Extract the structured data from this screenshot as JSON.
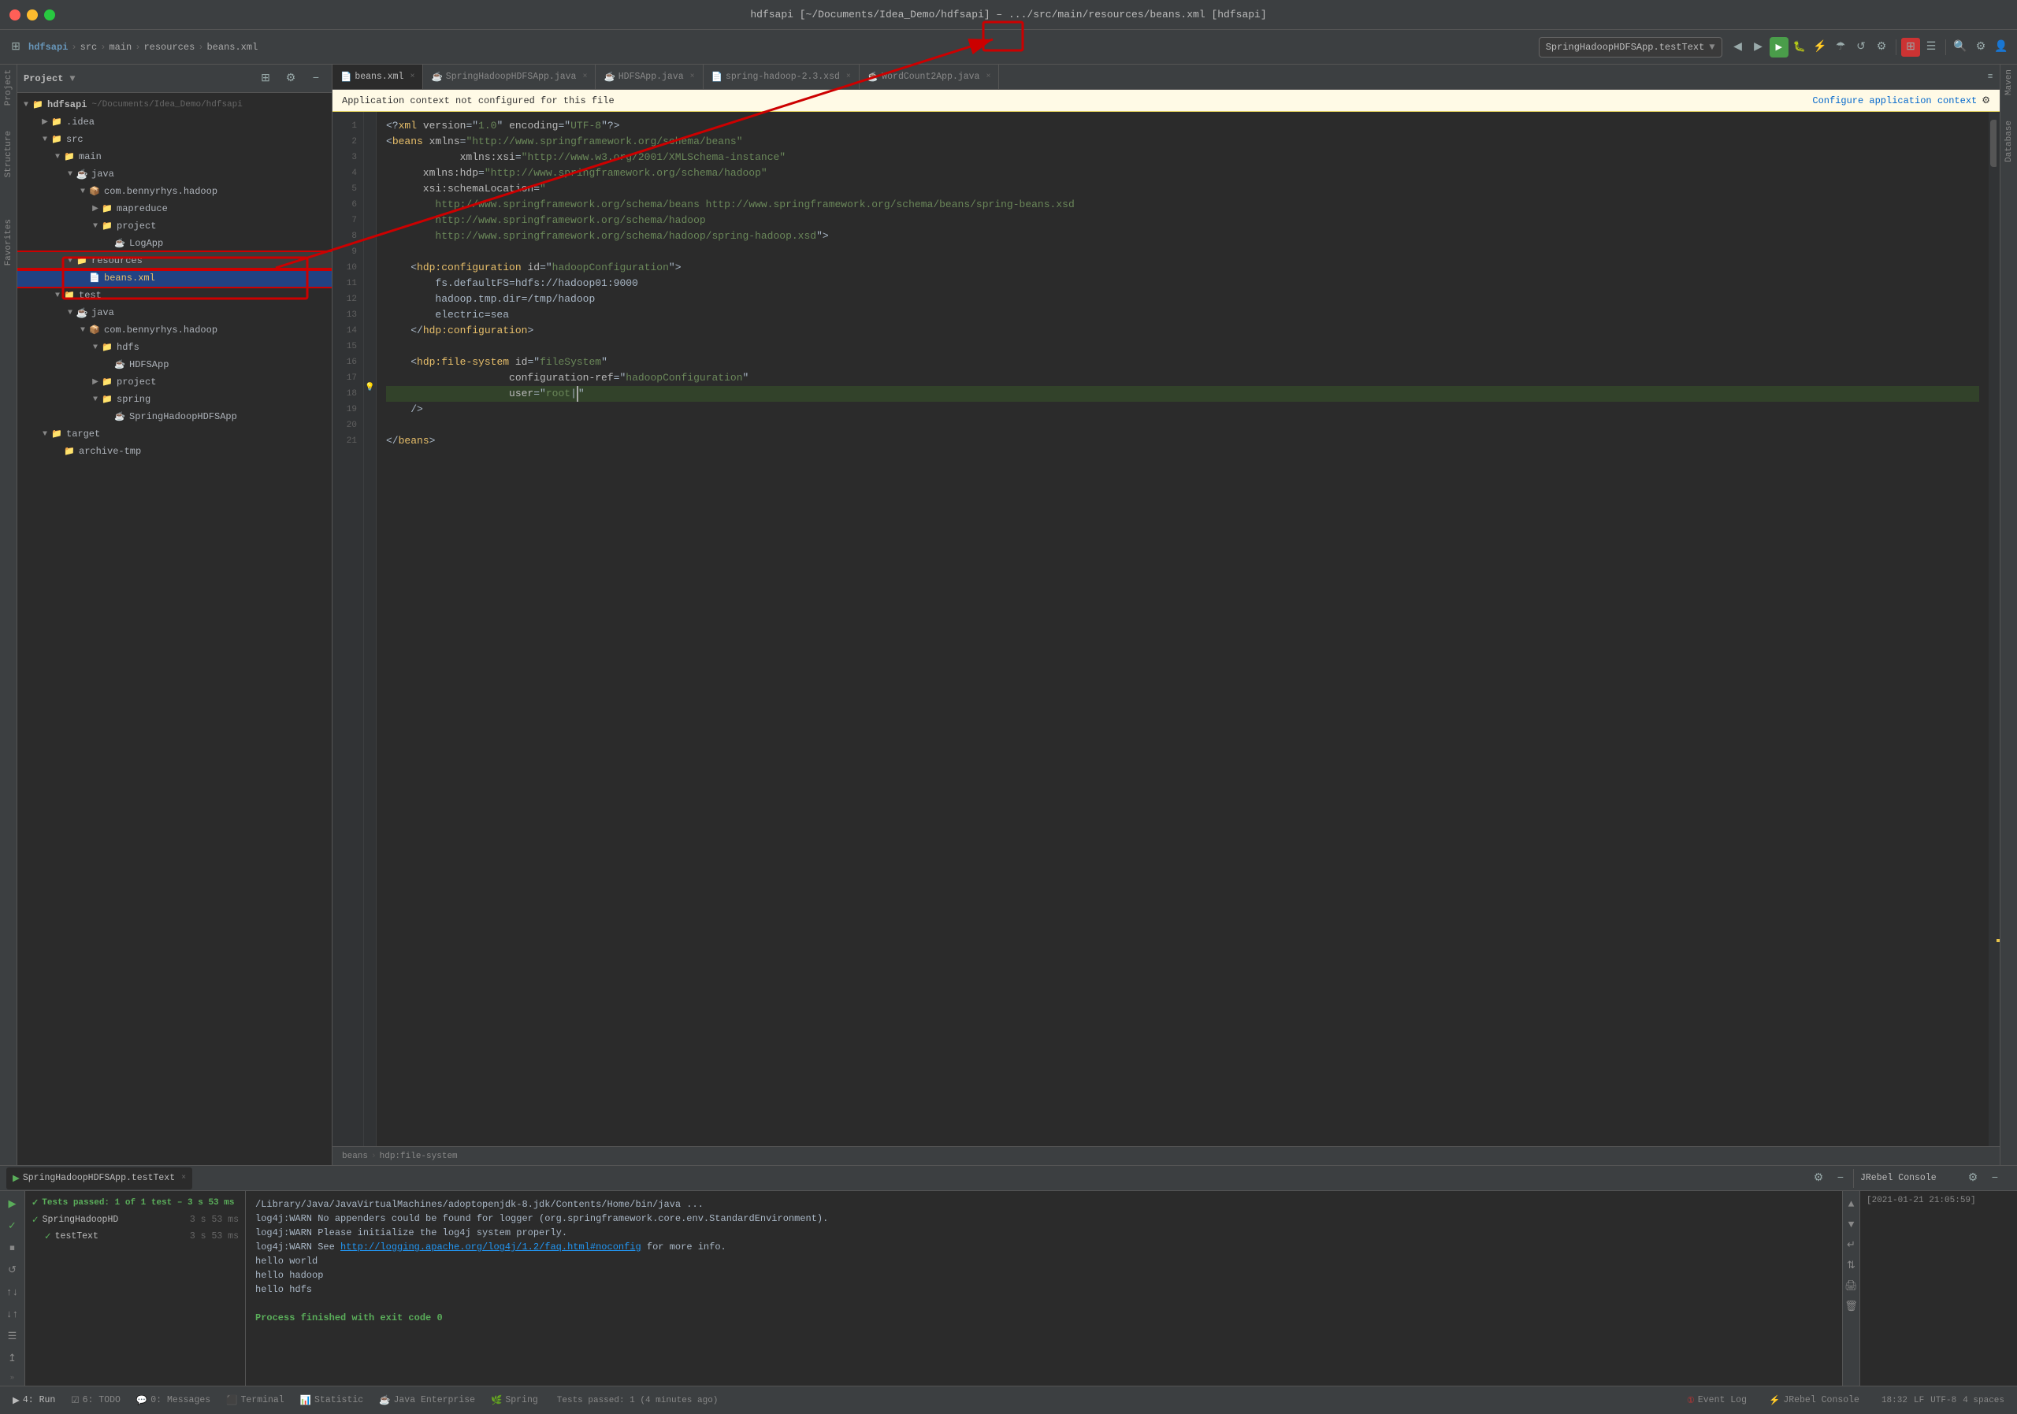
{
  "title_bar": {
    "title": "hdfsapi [~/Documents/Idea_Demo/hdfsapi] – .../src/main/resources/beans.xml [hdfsapi]"
  },
  "nav": {
    "breadcrumbs": [
      "hdfsapi",
      "src",
      "main",
      "resources",
      "beans.xml"
    ]
  },
  "editor_tabs": [
    {
      "label": "beans.xml",
      "active": true,
      "icon": "xml"
    },
    {
      "label": "SpringHadoopHDFSApp.java",
      "active": false,
      "icon": "java"
    },
    {
      "label": "HDFSApp.java",
      "active": false,
      "icon": "java"
    },
    {
      "label": "spring-hadoop-2.3.xsd",
      "active": false,
      "icon": "xsd"
    },
    {
      "label": "WordCount2App.java",
      "active": false,
      "icon": "java"
    }
  ],
  "warning": {
    "text": "Application context not configured for this file",
    "link_text": "Configure application context",
    "gear": "⚙"
  },
  "code": {
    "lines": [
      {
        "num": 1,
        "content": "<?xml version=\"1.0\" encoding=\"UTF-8\"?>"
      },
      {
        "num": 2,
        "content": "<beans xmlns=\"http://www.springframework.org/schema/beans\""
      },
      {
        "num": 3,
        "content": "      xmlns:xsi=\"http://www.w3.org/2001/XMLSchema-instance\""
      },
      {
        "num": 4,
        "content": "      xmlns:hdp=\"http://www.springframework.org/schema/hadoop\""
      },
      {
        "num": 5,
        "content": "      xsi:schemaLocation="
      },
      {
        "num": 6,
        "content": "        http://www.springframework.org/schema/beans http://www.springframework.org/schema/beans/spring-beans.xsd"
      },
      {
        "num": 7,
        "content": "        http://www.springframework.org/schema/hadoop"
      },
      {
        "num": 8,
        "content": "        http://www.springframework.org/schema/hadoop/spring-hadoop.xsd\">"
      },
      {
        "num": 9,
        "content": ""
      },
      {
        "num": 10,
        "content": "    <hdp:configuration id=\"hadoopConfiguration\">"
      },
      {
        "num": 11,
        "content": "        fs.defaultFS=hdfs://hadoop01:9000"
      },
      {
        "num": 12,
        "content": "        hadoop.tmp.dir=/tmp/hadoop"
      },
      {
        "num": 13,
        "content": "        electric=sea"
      },
      {
        "num": 14,
        "content": "    </hdp:configuration>"
      },
      {
        "num": 15,
        "content": ""
      },
      {
        "num": 16,
        "content": "    <hdp:file-system id=\"fileSystem\""
      },
      {
        "num": 17,
        "content": "                    configuration-ref=\"hadoopConfiguration\""
      },
      {
        "num": 18,
        "content": "                    user=\"root\""
      },
      {
        "num": 19,
        "content": "    />"
      },
      {
        "num": 20,
        "content": ""
      },
      {
        "num": 21,
        "content": "</beans>"
      }
    ]
  },
  "editor_breadcrumb": {
    "path": [
      "beans",
      "hdp:file-system"
    ]
  },
  "project_tree": {
    "root": "hdfsapi",
    "root_path": "~/Documents/Idea_Demo/hdfsapi",
    "items": [
      {
        "label": ".idea",
        "type": "folder",
        "indent": 1,
        "expanded": false
      },
      {
        "label": "src",
        "type": "folder",
        "indent": 1,
        "expanded": true
      },
      {
        "label": "main",
        "type": "folder",
        "indent": 2,
        "expanded": true
      },
      {
        "label": "java",
        "type": "folder",
        "indent": 3,
        "expanded": true
      },
      {
        "label": "com.bennyrhys.hadoop",
        "type": "package",
        "indent": 4,
        "expanded": true
      },
      {
        "label": "mapreduce",
        "type": "folder",
        "indent": 5,
        "expanded": false
      },
      {
        "label": "project",
        "type": "folder",
        "indent": 5,
        "expanded": true
      },
      {
        "label": "LogApp",
        "type": "java",
        "indent": 6
      },
      {
        "label": "resources",
        "type": "folder",
        "indent": 3,
        "expanded": true,
        "highlighted": true
      },
      {
        "label": "beans.xml",
        "type": "xml",
        "indent": 4,
        "selected": true,
        "highlighted": true
      },
      {
        "label": "test",
        "type": "folder",
        "indent": 2,
        "expanded": true
      },
      {
        "label": "java",
        "type": "folder",
        "indent": 3,
        "expanded": true
      },
      {
        "label": "com.bennyrhys.hadoop",
        "type": "package",
        "indent": 4,
        "expanded": true
      },
      {
        "label": "hdfs",
        "type": "folder",
        "indent": 5,
        "expanded": true
      },
      {
        "label": "HDFSApp",
        "type": "java",
        "indent": 6
      },
      {
        "label": "project",
        "type": "folder",
        "indent": 5,
        "expanded": false
      },
      {
        "label": "spring",
        "type": "folder",
        "indent": 5,
        "expanded": true
      },
      {
        "label": "SpringHadoopHDFSApp",
        "type": "java",
        "indent": 6
      },
      {
        "label": "target",
        "type": "folder",
        "indent": 1,
        "expanded": true
      },
      {
        "label": "archive-tmp",
        "type": "folder",
        "indent": 2,
        "expanded": false
      }
    ]
  },
  "run_panel": {
    "tab_label": "SpringHadoopHDFSApp.testText",
    "status_bar": "Tests passed: 1 of 1 test – 3 s 53 ms",
    "test_tree": [
      {
        "name": "SpringHadoopHD",
        "time": "3 s 53 ms",
        "pass": true
      },
      {
        "name": "testText",
        "time": "3 s 53 ms",
        "pass": true,
        "indent": 1
      }
    ],
    "console_lines": [
      "/Library/Java/JavaVirtualMachines/adoptopenjdk-8.jdk/Contents/Home/bin/java ...",
      "log4j:WARN No appenders could be found for logger (org.springframework.core.env.StandardEnvironment).",
      "log4j:WARN Please initialize the log4j system properly.",
      "log4j:WARN See http://logging.apache.org/log4j/1.2/faq.html#noconfig for more info.",
      "hello world",
      "hello hadoop",
      "hello hdfs",
      "",
      "Process finished with exit code 0"
    ]
  },
  "bottom_tools": [
    {
      "label": "4: Run",
      "icon": "▶",
      "active": true
    },
    {
      "label": "6: TODO",
      "icon": "☑"
    },
    {
      "label": "0: Messages",
      "icon": "💬"
    },
    {
      "label": "Terminal",
      "icon": "⬛"
    },
    {
      "label": "Statistic",
      "icon": "📊"
    },
    {
      "label": "Java Enterprise",
      "icon": "☕"
    },
    {
      "label": "Spring",
      "icon": "🌿"
    }
  ],
  "status_bar": {
    "left": "Tests passed: 1 (4 minutes ago)",
    "right_items": [
      "18:32",
      "LF",
      "UTF-8",
      "4 spaces"
    ]
  },
  "jrebel": {
    "title": "JRebel Console",
    "timestamp": "[2021-01-21 21:05:59]"
  },
  "right_panel_tabs": [
    "Maven",
    "Database"
  ],
  "bottom_right_tools": [
    "Event Log",
    "JRebel Console"
  ],
  "run_toolbar_buttons": [
    "▶",
    "⏹",
    "↺",
    "↕",
    "↕",
    "↔",
    "↑",
    "⊞",
    "≡"
  ],
  "nav_right_buttons": [
    "◀",
    "▶",
    "▶",
    "⏸",
    "⚙",
    "↑",
    "↓",
    "🐛",
    "🚀",
    "📷",
    "🔍",
    "🔎",
    "📋",
    "👤"
  ]
}
